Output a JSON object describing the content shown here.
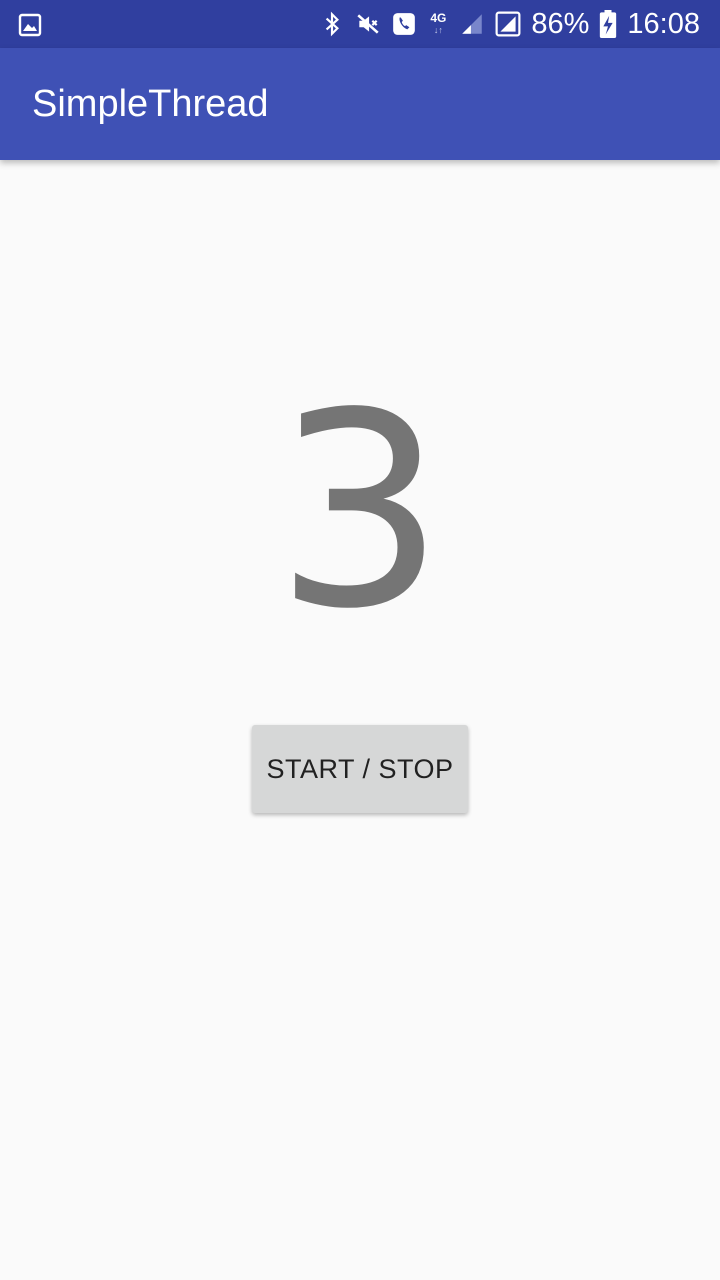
{
  "status_bar": {
    "left_icon": "gallery-icon",
    "icons": [
      "bluetooth-icon",
      "mute-icon",
      "call-icon",
      "4g-icon",
      "signal-icon",
      "signal-boxed-icon",
      "battery-charging-icon"
    ],
    "network_label": "4G",
    "battery_percent": "86%",
    "time": "16:08"
  },
  "app_bar": {
    "title": "SimpleThread"
  },
  "main": {
    "counter_value": "3",
    "button_label": "START / STOP"
  },
  "colors": {
    "status_bar": "#303f9f",
    "app_bar": "#3f51b5",
    "background": "#fafafa",
    "counter_text": "#757575",
    "button": "#d6d7d7"
  }
}
